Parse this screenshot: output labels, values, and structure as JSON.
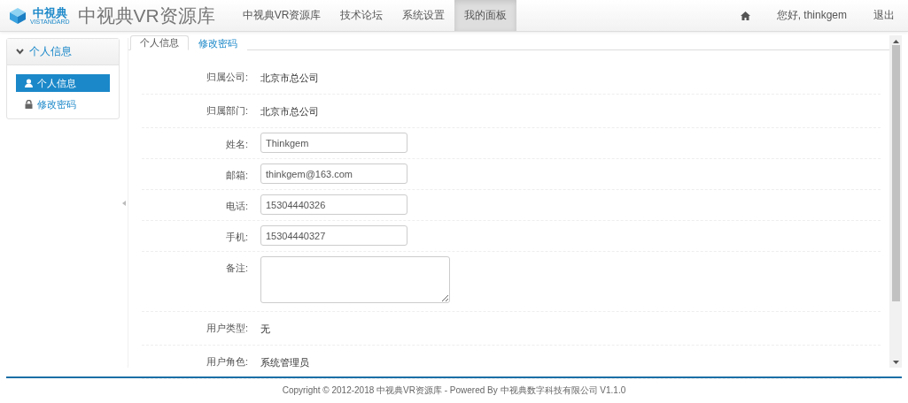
{
  "header": {
    "logo_text": "中視典",
    "logo_subtext": "VISTANDARD",
    "title": "中视典VR资源库",
    "nav": [
      {
        "label": "中视典VR资源库",
        "selected": false
      },
      {
        "label": "技术论坛",
        "selected": false
      },
      {
        "label": "系统设置",
        "selected": false
      },
      {
        "label": "我的面板",
        "selected": true
      }
    ],
    "greeting": "您好, thinkgem",
    "logout": "退出"
  },
  "sidebar": {
    "title": "个人信息",
    "expanded": true,
    "items": [
      {
        "label": "个人信息",
        "kind": "user",
        "selected": true
      },
      {
        "label": "修改密码",
        "kind": "lock",
        "selected": false
      }
    ]
  },
  "tabs": [
    {
      "label": "个人信息",
      "selected": true
    },
    {
      "label": "修改密码",
      "selected": false
    }
  ],
  "form": [
    {
      "kind": "static",
      "label": "归属公司:",
      "value": "北京市总公司"
    },
    {
      "kind": "static",
      "label": "归属部门:",
      "value": "北京市总公司"
    },
    {
      "kind": "input",
      "label": "姓名:",
      "value": "Thinkgem"
    },
    {
      "kind": "input",
      "label": "邮箱:",
      "value": "thinkgem@163.com"
    },
    {
      "kind": "input",
      "label": "电话:",
      "value": "15304440326"
    },
    {
      "kind": "input",
      "label": "手机:",
      "value": "15304440327"
    },
    {
      "kind": "textarea",
      "label": "备注:"
    },
    {
      "kind": "static",
      "label": "用户类型:",
      "value": "无"
    },
    {
      "kind": "static",
      "label": "用户角色:",
      "value": "系统管理员"
    }
  ],
  "footer": "Copyright © 2012-2018 中视典VR资源库 - Powered By 中视典数字科技有限公司 V1.1.0"
}
